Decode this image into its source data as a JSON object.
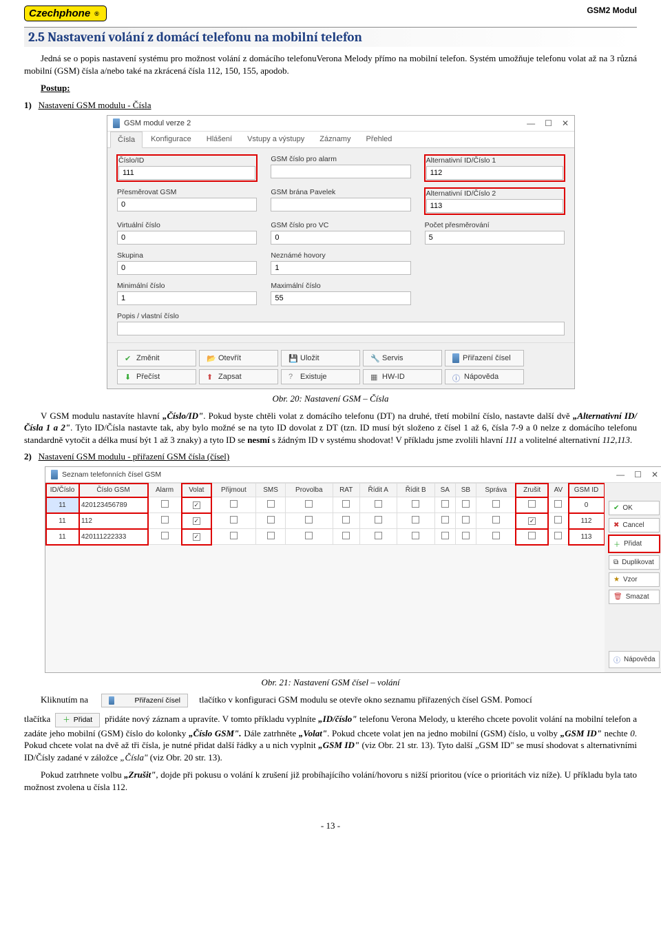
{
  "header": {
    "logo": "Czechphone",
    "right": "GSM2 Modul"
  },
  "section": {
    "title": "2.5  Nastavení volání z domácí telefonu na mobilní telefon"
  },
  "intro": {
    "p1": "Jedná se o popis nastavení systému pro možnost volání z domácího telefonuVerona Melody přímo na mobilní telefon. Systém umožňuje telefonu volat až na 3 různá mobilní (GSM) čísla a/nebo také na zkrácená čísla 112, 150, 155, apodob.",
    "postup": "Postup:"
  },
  "step1": {
    "num": "1)",
    "txt": "Nastavení GSM modulu - Čísla"
  },
  "app1": {
    "title": "GSM modul verze 2",
    "tabs": [
      "Čísla",
      "Konfigurace",
      "Hlášení",
      "Vstupy a výstupy",
      "Záznamy",
      "Přehled"
    ],
    "fields": {
      "cislo_id": {
        "label": "Číslo/ID",
        "value": "111"
      },
      "gsm_alarm": {
        "label": "GSM číslo pro alarm",
        "value": ""
      },
      "alt1": {
        "label": "Alternativní ID/Číslo 1",
        "value": "112"
      },
      "presmer": {
        "label": "Přesměrovat GSM",
        "value": "0"
      },
      "brana": {
        "label": "GSM brána Pavelek",
        "value": ""
      },
      "alt2": {
        "label": "Alternativní ID/Číslo 2",
        "value": "113"
      },
      "virt": {
        "label": "Virtuální číslo",
        "value": "0"
      },
      "vc": {
        "label": "GSM číslo pro VC",
        "value": "0"
      },
      "pocet": {
        "label": "Počet přesměrování",
        "value": "5"
      },
      "skupina": {
        "label": "Skupina",
        "value": "0"
      },
      "nezname": {
        "label": "Neznámé hovory",
        "value": "1"
      },
      "min": {
        "label": "Minimální číslo",
        "value": "1"
      },
      "max": {
        "label": "Maximální číslo",
        "value": "55"
      },
      "popis": {
        "label": "Popis / vlastní číslo",
        "value": ""
      }
    },
    "buttons": {
      "zmenit": "Změnit",
      "otevrit": "Otevřít",
      "ulozit": "Uložit",
      "servis": "Servis",
      "prirazeni": "Přiřazení čísel",
      "precist": "Přečíst",
      "zapsat": "Zapsat",
      "existuje": "Existuje",
      "hwid": "HW-ID",
      "napoveda": "Nápověda"
    }
  },
  "caption1": "Obr. 20: Nastavení GSM – Čísla",
  "para2_parts": {
    "a": "V GSM modulu nastavíte hlavní ",
    "b": "„Číslo/ID\"",
    "c": ". Pokud byste chtěli volat z domácího telefonu (DT) na druhé, třetí mobilní číslo, nastavte další dvě ",
    "d": "„Alternativní ID/Čísla 1 a 2\"",
    "e": ". Tyto ID/Čísla nastavte tak, aby bylo možné se na tyto ID dovolat z DT (tzn. ID musí být složeno z čísel 1 až 6, čísla 7-9 a 0 nelze z domácího telefonu standardně vytočit a délka musí být 1 až 3 znaky) a tyto ID se ",
    "f": "nesmí",
    "g": " s žádným ID v systému shodovat! V příkladu jsme zvolili hlavní ",
    "h": "111",
    "i": " a volitelné alternativní ",
    "j": "112,113",
    "k": "."
  },
  "step2": {
    "num": "2)",
    "txt": "Nastavení GSM modulu - přiřazení GSM čísla (čísel)"
  },
  "app2": {
    "title": "Seznam telefonních čísel GSM",
    "headers": [
      "ID/Číslo",
      "Číslo GSM",
      "Alarm",
      "Volat",
      "Přijmout",
      "SMS",
      "Provolba",
      "RAT",
      "Řídit A",
      "Řídit B",
      "SA",
      "SB",
      "Správa",
      "Zrušit",
      "AV",
      "GSM ID"
    ],
    "rows": [
      {
        "id": "11",
        "gsm": "420123456789",
        "volat": true,
        "zrusit": false,
        "gsmid": "0"
      },
      {
        "id": "11",
        "gsm": "112",
        "volat": true,
        "zrusit": true,
        "gsmid": "112"
      },
      {
        "id": "11",
        "gsm": "420111222333",
        "volat": true,
        "zrusit": false,
        "gsmid": "113"
      }
    ],
    "side": {
      "ok": "OK",
      "cancel": "Cancel",
      "pridat": "Přidat",
      "dup": "Duplikovat",
      "vzor": "Vzor",
      "smazat": "Smazat",
      "napoveda": "Nápověda"
    }
  },
  "caption2": "Obr. 21: Nastavení GSM čísel – volání",
  "para3_parts": {
    "a": "Kliknutím  na",
    "inline1": "Přiřazení čísel",
    "b": "tlačítko v konfiguraci GSM modulu se otevře okno seznamu přiřazených čísel GSM. Pomocí",
    "c": "tlačítka",
    "inline2": "Přidat",
    "d": "přidáte nový záznam a upravíte. V tomto příkladu vyplníte ",
    "e": "„ID/číslo\"",
    "f": " telefonu Verona Melody, u kterého chcete povolit volání na mobilní telefon a zadáte jeho mobilní (GSM) číslo do kolonky ",
    "g": "„Číslo GSM\".",
    "h": " Dále zatrhněte ",
    "i": "„Volat\"",
    "j": ". Pokud chcete volat jen na jedno mobilní  (GSM)  číslo,  u  volby  ",
    "k": "„GSM  ID\"",
    "l": "  nechte  ",
    "m": "0",
    "n": ".  Pokud  chcete  volat  na  dvě  až  tři  čísla,  je  nutné  přidat  další  řádky  a  u  nich  vyplnit ",
    "o": "„GSM ID\"",
    "p": " (viz Obr. 21 str. 13). Tyto další „GSM ID\" se musí shodovat s alternativními ID/Čísly zadané v záložce ",
    "q": "„Čísla\"",
    "r": " (viz Obr. 20 str. 13).",
    "s": "Pokud zatrhnete volbu ",
    "t": "„Zrušit\"",
    "u": ", dojde při pokusu o volání k zrušení již probíhajícího volání/hovoru s nižší prioritou (více o prioritách viz níže). U příkladu byla tato možnost zvolena u čísla 112."
  },
  "pagenum": "- 13 -"
}
